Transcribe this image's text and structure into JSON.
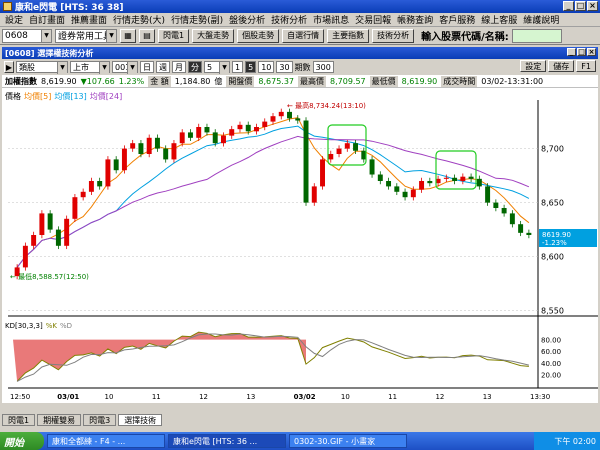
{
  "window": {
    "title": "康和e閃電 [HTS: 36 38]",
    "buttons": [
      "_",
      "□",
      "×"
    ]
  },
  "menu": [
    "設定",
    "自訂畫面",
    "推薦畫面",
    "行情走勢(大)",
    "行情走勢(副)",
    "盤後分析",
    "技術分析",
    "市場訊息",
    "交易回報",
    "帳務查詢",
    "客戶服務",
    "線上客服",
    "維護說明"
  ],
  "toolbar": {
    "code": "0608",
    "tool_select": "證券常用工具",
    "buttons": [
      "閃電1",
      "大盤走勢",
      "個股走勢",
      "自選行情",
      "主要指數",
      "技術分析"
    ],
    "symbol_label": "輸入股票代碼/名稱:"
  },
  "subwindow": {
    "title": "[0608] 選擇權技術分析",
    "buttons": [
      "_",
      "□",
      "×"
    ]
  },
  "controls": {
    "left_combo": "類股",
    "market_combo": "上市",
    "code_combo": "001",
    "period_tabs": [
      "日",
      "週",
      "月",
      "分"
    ],
    "interval": "5",
    "ranges": [
      "1",
      "5",
      "10",
      "30"
    ],
    "bars_label": "期數",
    "bars_value": "300",
    "right_buttons": [
      "設定",
      "儲存",
      "F1"
    ]
  },
  "info": {
    "name": "加權指數",
    "price": "8,619.90",
    "change": "▼107.66",
    "change_pct": "1.23%",
    "amount_label": "金 額",
    "amount": "1,184.80",
    "amount_unit": "億",
    "open_label": "開盤價",
    "open": "8,675.37",
    "high_label": "最高價",
    "high": "8,709.57",
    "low_label": "最低價",
    "low": "8,619.90",
    "time_label": "成交時間",
    "time": "03/02-13:31:00"
  },
  "legend": {
    "label": "價格",
    "ma1": "均價[5]",
    "ma2": "均價[13]",
    "ma3": "均價[24]"
  },
  "chart_data": {
    "type": "candlestick",
    "y_ticks": [
      "8,700",
      "8,650",
      "8,600",
      "8,550"
    ],
    "ylim": [
      8545,
      8745
    ],
    "x_labels": [
      "12:50",
      "03/01",
      "10",
      "11",
      "12",
      "13",
      "03/02",
      "10",
      "11",
      "12",
      "13",
      "13:30"
    ],
    "annotation_high": "最高8,734.24(13:10)",
    "annotation_low": "最低8,588.57(12:50)",
    "last_price_label": "8619.90",
    "last_change_label": "-1.23%",
    "colors": {
      "up": "#e00000",
      "down": "#006600",
      "ma5": "#f08000",
      "ma13": "#00a0e0",
      "ma24": "#a040c0",
      "highlight": "#22cc22"
    },
    "closes": [
      8590,
      8610,
      8620,
      8640,
      8625,
      8610,
      8635,
      8655,
      8660,
      8670,
      8665,
      8690,
      8680,
      8700,
      8705,
      8695,
      8710,
      8700,
      8690,
      8705,
      8715,
      8710,
      8720,
      8715,
      8705,
      8712,
      8718,
      8722,
      8716,
      8720,
      8725,
      8730,
      8734,
      8728,
      8726,
      8650,
      8665,
      8690,
      8695,
      8700,
      8705,
      8698,
      8690,
      8676,
      8670,
      8665,
      8660,
      8655,
      8662,
      8670,
      8668,
      8672,
      8673,
      8670,
      8674,
      8672,
      8665,
      8650,
      8645,
      8640,
      8630,
      8622,
      8620
    ]
  },
  "kd": {
    "label": "KD[30,3,3]",
    "k_label": "%K",
    "d_label": "%D",
    "y_ticks": [
      "80.00",
      "60.00",
      "40.00",
      "20.00"
    ]
  },
  "bottom_tabs": [
    "閃電1",
    "期權雙易",
    "閃電3",
    "選擇技術"
  ],
  "taskbar": {
    "start": "開始",
    "tasks": [
      "康和全都練 - F4 - ...",
      "康和e閃電 [HTS: 36 ...",
      "0302-30.GIF - 小畫家"
    ],
    "clock": "下午 02:00"
  }
}
